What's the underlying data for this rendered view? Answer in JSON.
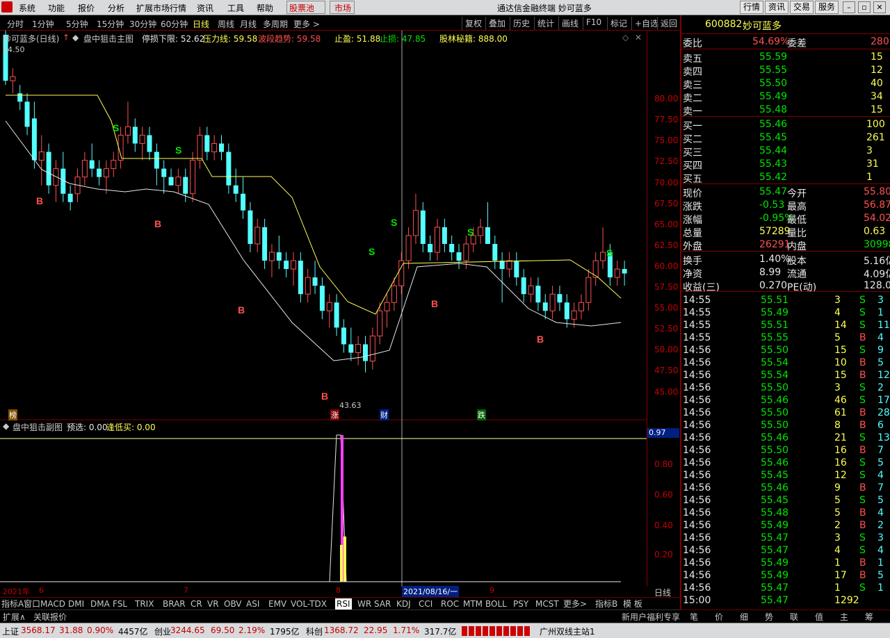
{
  "menu": [
    "系统",
    "功能",
    "报价",
    "分析",
    "扩展市场行情",
    "资讯",
    "工具",
    "帮助"
  ],
  "menu_red": [
    "股票池",
    "市场"
  ],
  "window_title": "通达信金融终端  妙可蓝多",
  "top_right": [
    "行情",
    "资讯",
    "交易",
    "服务"
  ],
  "timeframes": [
    "分时",
    "1分钟",
    "5分钟",
    "15分钟",
    "30分钟",
    "60分钟",
    "日线",
    "周线",
    "月线",
    "多周期",
    "更多 >"
  ],
  "toolbar_right": [
    "复权",
    "叠加",
    "历史",
    "统计",
    "画线",
    "F10",
    "标记",
    "+自选",
    "返回"
  ],
  "legend": {
    "name": "妙可蓝多(日线)",
    "indicator": "盘中狙击主图",
    "stoploss_floor": "停损下限: 52.62",
    "pressure": "压力线: 59.58",
    "wave": "波段趋势: 59.58",
    "profit": "止盈: 51.88",
    "stop": "止损: 47.85",
    "secret": "股林秘籍: 888.00"
  },
  "price_ticks": [
    "80.00",
    "77.50",
    "75.00",
    "72.50",
    "70.00",
    "67.50",
    "65.00",
    "62.50",
    "60.00",
    "57.50",
    "55.00",
    "52.50",
    "50.00",
    "47.50",
    "45.00"
  ],
  "high_label": "84.50",
  "low_label": "43.63",
  "markers_bottom": [
    "榜",
    "涨",
    "财",
    "跌"
  ],
  "ind_legend": {
    "name": "盘中狙击副图",
    "pre": "预选: 0.00",
    "buy": "逢低买: 0.00"
  },
  "ind_ticks": [
    "0.97",
    "0.80",
    "0.60",
    "0.40",
    "0.20"
  ],
  "dates": [
    "2021年",
    "6",
    "7",
    "8",
    "9"
  ],
  "cursor_date": "2021/08/16/一",
  "period_label": "日线",
  "indicator_tabs": [
    "指标A",
    "窗口",
    "MACD",
    "DMI",
    "DMA",
    "FSL",
    "TRIX",
    "BRAR",
    "CR",
    "VR",
    "OBV",
    "ASI",
    "EMV",
    "VOL-TDX",
    "RSI",
    "WR",
    "SAR",
    "KDJ",
    "CCI",
    "ROC",
    "MTM",
    "BOLL",
    "PSY",
    "MCST",
    "更多",
    ">",
    "指标B",
    "模 板"
  ],
  "ext_tabs": [
    "扩展∧",
    "关联报价"
  ],
  "status": {
    "sh_name": "上证",
    "sh_val": "3568.17",
    "sh_chg": "31.88",
    "sh_pct": "0.90%",
    "sh_amt": "4457亿",
    "cy_name": "创业",
    "cy_val": "3244.65",
    "cy_chg": "69.50",
    "cy_pct": "2.19%",
    "cy_amt": "1795亿",
    "kc_name": "科创",
    "kc_val": "1368.72",
    "kc_chg": "22.95",
    "kc_pct": "1.71%",
    "kc_amt": "317.7亿",
    "server": "广州双线主站1",
    "new_user": "新用户福利专享"
  },
  "quote": {
    "code": "600882",
    "name": "妙可蓝多",
    "ratio_label": "委比",
    "ratio": "54.69%",
    "diff_label": "委差",
    "diff": "280",
    "asks": [
      [
        "卖五",
        "55.59",
        "15"
      ],
      [
        "卖四",
        "55.55",
        "12"
      ],
      [
        "卖三",
        "55.50",
        "40"
      ],
      [
        "卖二",
        "55.49",
        "34"
      ],
      [
        "卖一",
        "55.48",
        "15"
      ]
    ],
    "bids": [
      [
        "买一",
        "55.46",
        "100"
      ],
      [
        "买二",
        "55.45",
        "261"
      ],
      [
        "买三",
        "55.44",
        "3"
      ],
      [
        "买四",
        "55.43",
        "31"
      ],
      [
        "买五",
        "55.42",
        "1"
      ]
    ],
    "stats": [
      [
        "现价",
        "55.47",
        "今开",
        "55.80"
      ],
      [
        "涨跌",
        "-0.53",
        "最高",
        "56.87"
      ],
      [
        "涨幅",
        "-0.95%",
        "最低",
        "54.02"
      ],
      [
        "总量",
        "57289",
        "量比",
        "0.63"
      ],
      [
        "外盘",
        "26291",
        "内盘",
        "30998"
      ]
    ],
    "stats2": [
      [
        "换手",
        "1.40%",
        "股本",
        "5.16亿"
      ],
      [
        "净资",
        "8.99",
        "流通",
        "4.09亿"
      ],
      [
        "收益(三)",
        "0.270",
        "PE(动)",
        "128.0"
      ]
    ],
    "ticks": [
      [
        "14:55",
        "55.51",
        "3",
        "S",
        "3"
      ],
      [
        "14:55",
        "55.49",
        "4",
        "S",
        "1"
      ],
      [
        "14:55",
        "55.51",
        "14",
        "S",
        "11"
      ],
      [
        "14:55",
        "55.55",
        "5",
        "B",
        "4"
      ],
      [
        "14:56",
        "55.50",
        "15",
        "S",
        "9"
      ],
      [
        "14:56",
        "55.54",
        "10",
        "B",
        "5"
      ],
      [
        "14:56",
        "55.54",
        "15",
        "B",
        "12"
      ],
      [
        "14:56",
        "55.50",
        "3",
        "S",
        "2"
      ],
      [
        "14:56",
        "55.46",
        "46",
        "S",
        "17"
      ],
      [
        "14:56",
        "55.50",
        "61",
        "B",
        "28"
      ],
      [
        "14:56",
        "55.50",
        "8",
        "B",
        "6"
      ],
      [
        "14:56",
        "55.46",
        "21",
        "S",
        "13"
      ],
      [
        "14:56",
        "55.50",
        "16",
        "B",
        "7"
      ],
      [
        "14:56",
        "55.46",
        "16",
        "S",
        "5"
      ],
      [
        "14:56",
        "55.45",
        "12",
        "S",
        "4"
      ],
      [
        "14:56",
        "55.46",
        "9",
        "B",
        "7"
      ],
      [
        "14:56",
        "55.45",
        "5",
        "S",
        "5"
      ],
      [
        "14:56",
        "55.48",
        "5",
        "B",
        "4"
      ],
      [
        "14:56",
        "55.49",
        "2",
        "B",
        "2"
      ],
      [
        "14:56",
        "55.47",
        "3",
        "S",
        "3"
      ],
      [
        "14:56",
        "55.47",
        "4",
        "S",
        "4"
      ],
      [
        "14:56",
        "55.49",
        "1",
        "B",
        "1"
      ],
      [
        "14:56",
        "55.49",
        "17",
        "B",
        "5"
      ],
      [
        "14:56",
        "55.47",
        "1",
        "S",
        "1"
      ],
      [
        "15:00",
        "55.47",
        "1292",
        "",
        ""
      ]
    ],
    "bottom_tabs": [
      "笔",
      "价",
      "细",
      "势",
      "联",
      "值",
      "主",
      "筹"
    ]
  },
  "colors": {
    "up": "#ff5050",
    "down": "#54ffff",
    "yellow": "#ffff54",
    "frame": "#800000",
    "green": "#00e600"
  },
  "chart_data": {
    "type": "candlestick",
    "ylim": [
      43.63,
      84.5
    ],
    "candles": [
      [
        84,
        85,
        78,
        78.5
      ],
      [
        78.5,
        80,
        77,
        79
      ],
      [
        77,
        78,
        75,
        76
      ],
      [
        76,
        77,
        72,
        73
      ],
      [
        74,
        76,
        68,
        69
      ],
      [
        69,
        72,
        66,
        70
      ],
      [
        70,
        71,
        65,
        66
      ],
      [
        66,
        69,
        64,
        68
      ],
      [
        68,
        70,
        64,
        65
      ],
      [
        65,
        66,
        63,
        64
      ],
      [
        65,
        68,
        64,
        67
      ],
      [
        67,
        70,
        66,
        69
      ],
      [
        69,
        71,
        67,
        68
      ],
      [
        68,
        69,
        66,
        67
      ],
      [
        67,
        69,
        65,
        68
      ],
      [
        68,
        70,
        67,
        69
      ],
      [
        69,
        73,
        68,
        72
      ],
      [
        72,
        76,
        71,
        73
      ],
      [
        73,
        74,
        70,
        71
      ],
      [
        71,
        73,
        69,
        72
      ],
      [
        72,
        73,
        69,
        70
      ],
      [
        70,
        71,
        66,
        68
      ],
      [
        68,
        69,
        65,
        67
      ],
      [
        67,
        68,
        66,
        66
      ],
      [
        66,
        68,
        65,
        67
      ],
      [
        67,
        68,
        64,
        65
      ],
      [
        65,
        70,
        64,
        69
      ],
      [
        69,
        73,
        68,
        72
      ],
      [
        72,
        73,
        69,
        70
      ],
      [
        70,
        72,
        69,
        71
      ],
      [
        71,
        72,
        69,
        70
      ],
      [
        70,
        71,
        65,
        66
      ],
      [
        66,
        68,
        64,
        65
      ],
      [
        65,
        67,
        62,
        63
      ],
      [
        63,
        64,
        58,
        59
      ],
      [
        59,
        62,
        58,
        61
      ],
      [
        61,
        62,
        56,
        57
      ],
      [
        57,
        59,
        55,
        58
      ],
      [
        58,
        60,
        56,
        57
      ],
      [
        57,
        58,
        55,
        56
      ],
      [
        56,
        58,
        54,
        57
      ],
      [
        57,
        58,
        52,
        53
      ],
      [
        53,
        56,
        52,
        55
      ],
      [
        55,
        57,
        53,
        54
      ],
      [
        54,
        55,
        50,
        51
      ],
      [
        51,
        53,
        49,
        52
      ],
      [
        52,
        53,
        48,
        49
      ],
      [
        49,
        50,
        46,
        47
      ],
      [
        47,
        49,
        45,
        46
      ],
      [
        46,
        48,
        44.5,
        47
      ],
      [
        47,
        48,
        43.63,
        45
      ],
      [
        45,
        49,
        44,
        48
      ],
      [
        48,
        52,
        47,
        51
      ],
      [
        51,
        53,
        49,
        52
      ],
      [
        52,
        55,
        51,
        54
      ],
      [
        54,
        58,
        53,
        57
      ],
      [
        57,
        61,
        56,
        60
      ],
      [
        60,
        65,
        59,
        63
      ],
      [
        63,
        64,
        58,
        59
      ],
      [
        59,
        60,
        57,
        58
      ],
      [
        58,
        62,
        57,
        61
      ],
      [
        61,
        62,
        58,
        59
      ],
      [
        59,
        60,
        57,
        58
      ],
      [
        58,
        59,
        56,
        57
      ],
      [
        57,
        60,
        56,
        59
      ],
      [
        59,
        61,
        58,
        60
      ],
      [
        60,
        62,
        59,
        61
      ],
      [
        61,
        64,
        60,
        59
      ],
      [
        59,
        60,
        56,
        57
      ],
      [
        57,
        58,
        52,
        56
      ],
      [
        56,
        58,
        55,
        57
      ],
      [
        57,
        58,
        54,
        55
      ],
      [
        55,
        56,
        52,
        53
      ],
      [
        53,
        55,
        52,
        54
      ],
      [
        54,
        55,
        51,
        52
      ],
      [
        52,
        53,
        50,
        51
      ],
      [
        51,
        54,
        50,
        53
      ],
      [
        53,
        54,
        51,
        52
      ],
      [
        52,
        53,
        49,
        50
      ],
      [
        50,
        52,
        49,
        51
      ],
      [
        51,
        53,
        50,
        52
      ],
      [
        52,
        56,
        51,
        55
      ],
      [
        55,
        58,
        54,
        57
      ],
      [
        57,
        61,
        56,
        58
      ],
      [
        58,
        59,
        54,
        55
      ],
      [
        55,
        57,
        54,
        56
      ],
      [
        56,
        57,
        54,
        55.47
      ]
    ]
  }
}
